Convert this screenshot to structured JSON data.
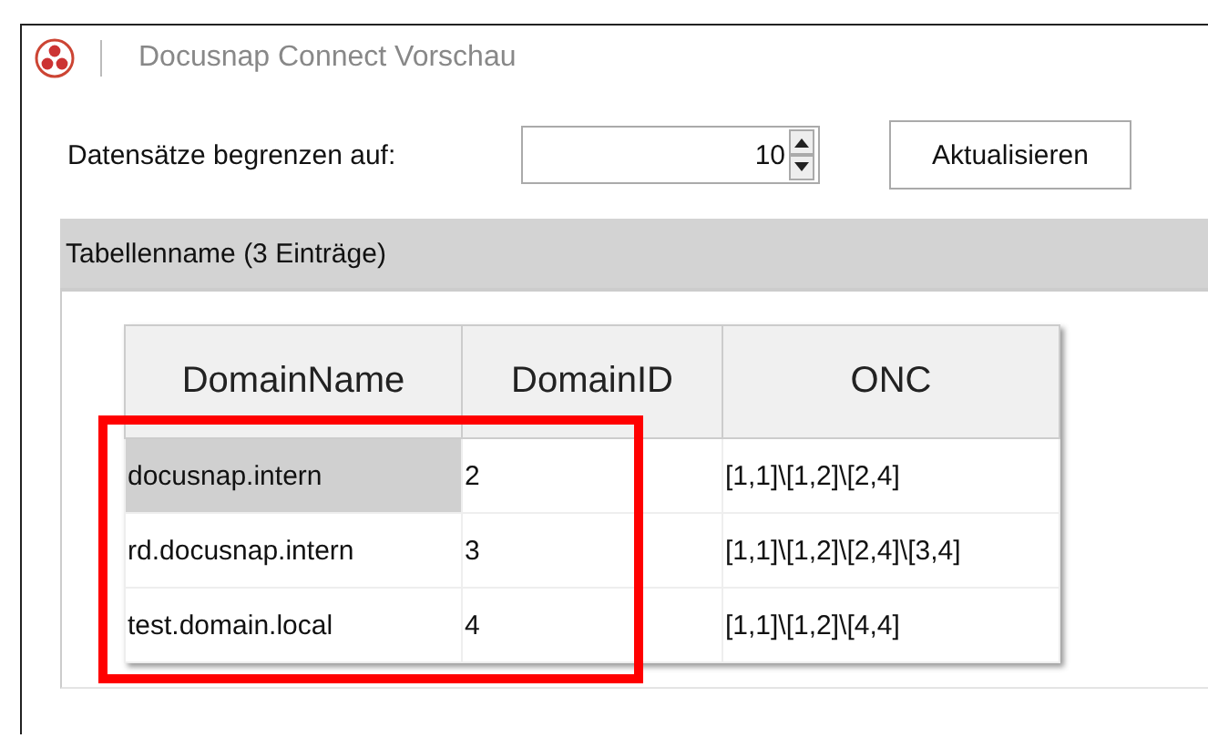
{
  "window": {
    "title": "Docusnap Connect Vorschau"
  },
  "limit": {
    "label": "Datensätze begrenzen auf:",
    "value": "10"
  },
  "refresh_button": "Aktualisieren",
  "group": {
    "title": "Tabellenname (3 Einträge)"
  },
  "table": {
    "columns": [
      "DomainName",
      "DomainID",
      "ONC"
    ],
    "rows": [
      {
        "cells": [
          "docusnap.intern",
          "2",
          "[1,1]\\[1,2]\\[2,4]"
        ],
        "selected": true
      },
      {
        "cells": [
          "rd.docusnap.intern",
          "3",
          "[1,1]\\[1,2]\\[2,4]\\[3,4]"
        ],
        "selected": false
      },
      {
        "cells": [
          "test.domain.local",
          "4",
          "[1,1]\\[1,2]\\[4,4]"
        ],
        "selected": false
      }
    ]
  }
}
